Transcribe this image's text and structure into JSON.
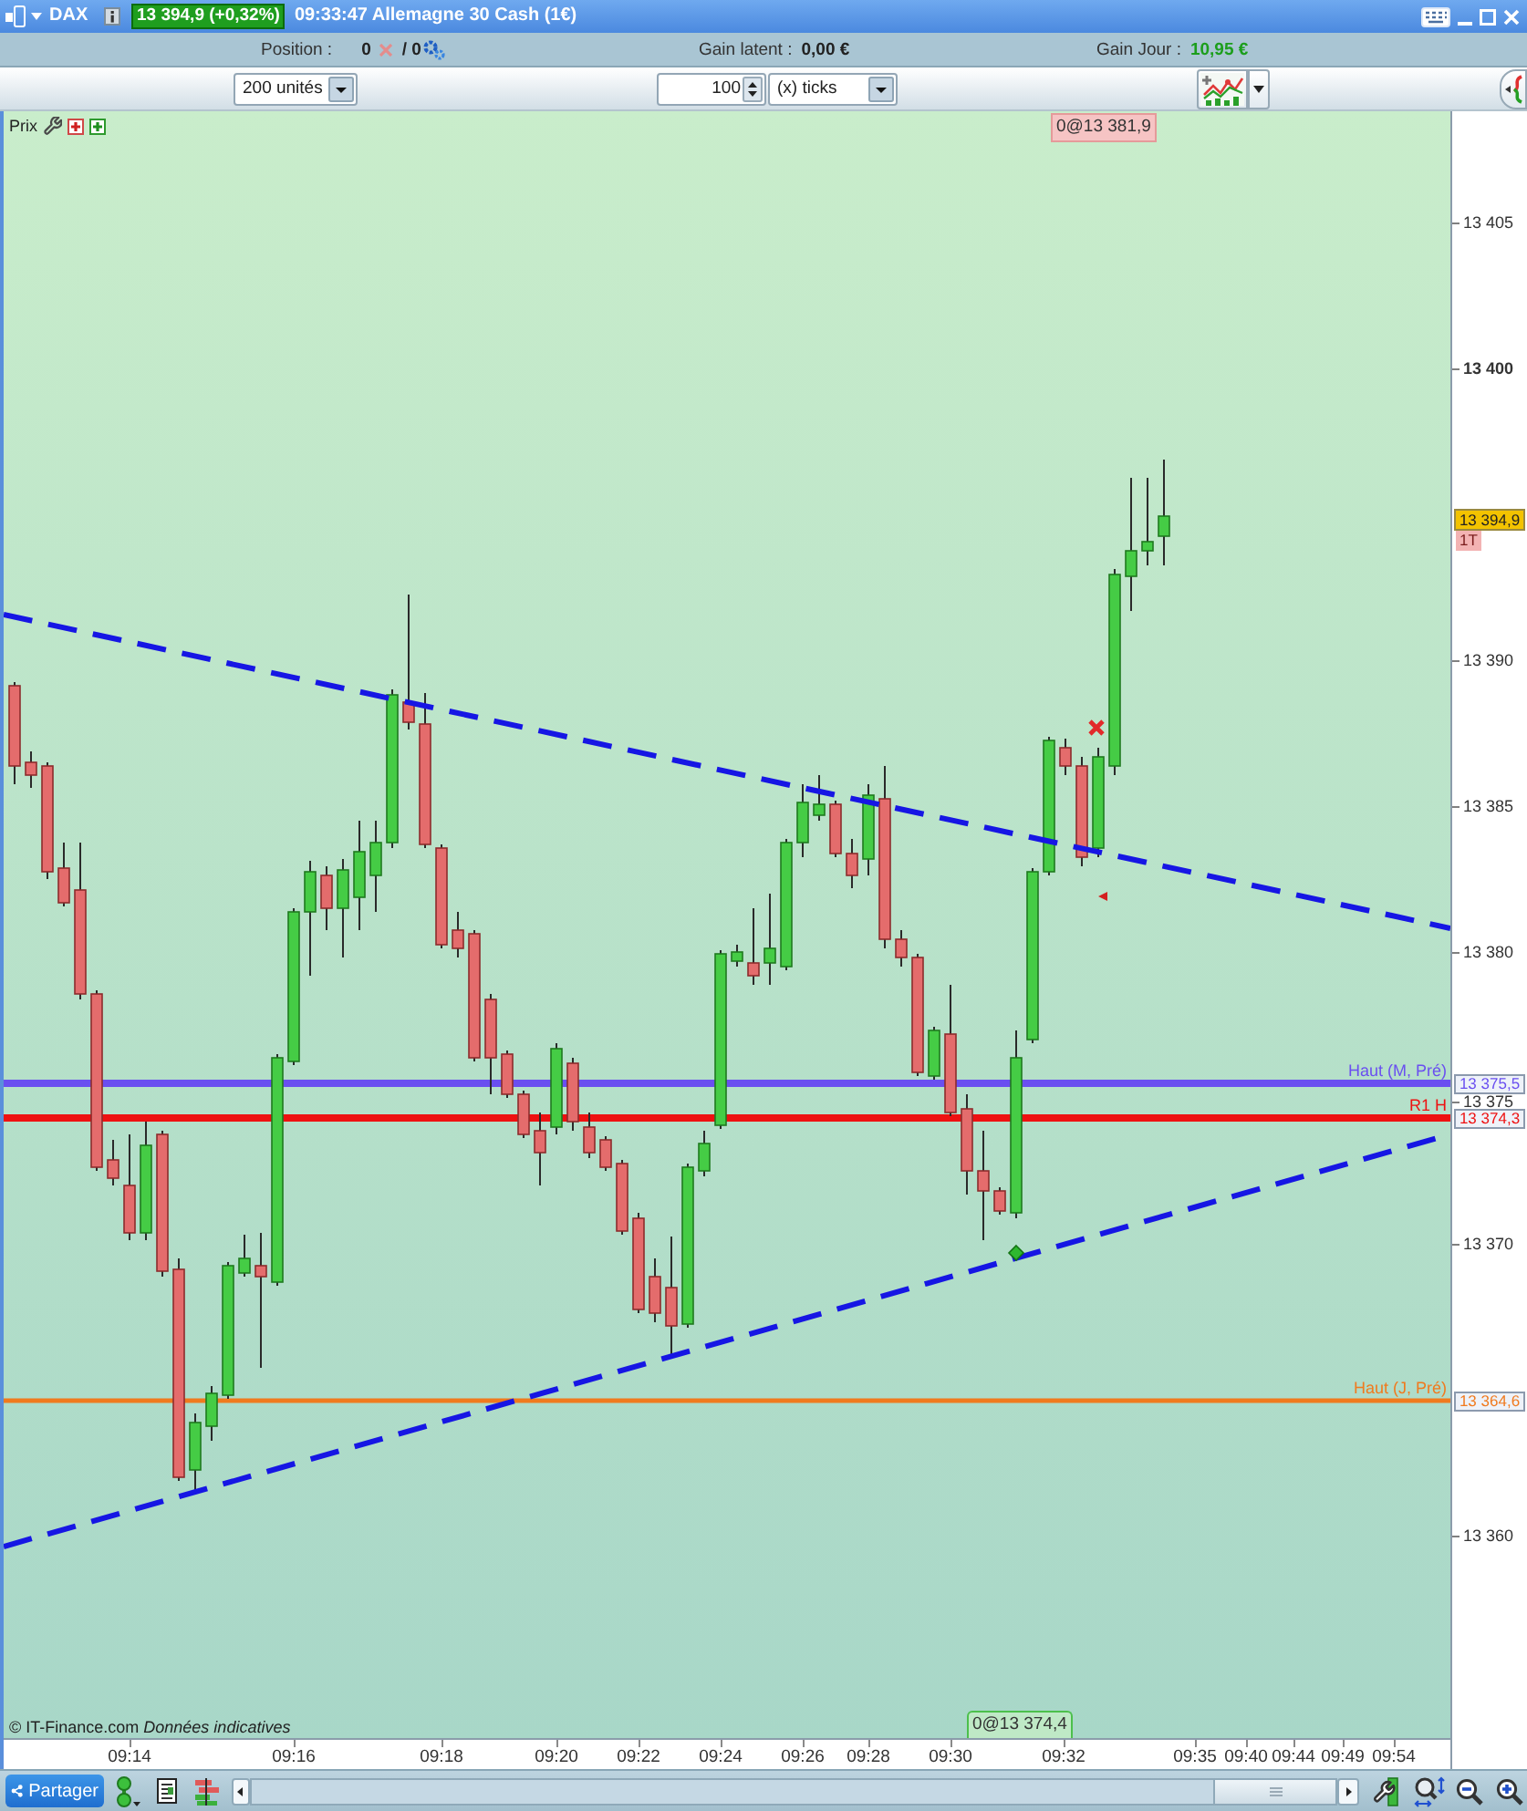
{
  "title_bar": {
    "instrument": "DAX",
    "quote": "13 394,9 (+0,32%)",
    "caption": "09:33:47 Allemagne 30 Cash (1€)"
  },
  "info_bar": {
    "position": {
      "label": "Position :",
      "value": "0",
      "total": "/ 0"
    },
    "unrealized": {
      "label": "Gain latent :",
      "value": "0,00 €"
    },
    "daily": {
      "label": "Gain Jour :",
      "value": "10,95 €"
    }
  },
  "toolbar": {
    "quantity": "200 unités",
    "step": "100",
    "step_unit": "(x) ticks"
  },
  "chart": {
    "panel_title": "Prix",
    "order_tags": [
      {
        "text": "0@13 381,9",
        "kind": "sell"
      },
      {
        "text": "0@13 374,4",
        "kind": "buy"
      }
    ],
    "source": "© IT-Finance.com *Données indicatives*",
    "price_ticks": [
      {
        "label": "13 405",
        "emphasized": false
      },
      {
        "label": "13 400",
        "emphasized": true
      },
      {
        "label": "13 390",
        "emphasized": false
      },
      {
        "label": "13 385",
        "emphasized": false
      },
      {
        "label": "13 380",
        "emphasized": false
      },
      {
        "label": "13 375",
        "emphasized": false
      },
      {
        "label": "13 370",
        "emphasized": false
      },
      {
        "label": "13 360",
        "emphasized": false
      }
    ],
    "last_price": {
      "value": "13 394,9",
      "tag": "1T"
    },
    "levels": [
      {
        "name": "Haut (M, Pré)",
        "price": "13 375,5",
        "color": "#6a4ff0"
      },
      {
        "name": "R1 H",
        "price": "13 374,3",
        "color": "#ee1111"
      },
      {
        "name": "Haut (J, Pré)",
        "price": "13 364,6",
        "color": "#f07a1e"
      }
    ],
    "time_ticks": [
      "09:14",
      "09:16",
      "09:18",
      "09:20",
      "09:22",
      "09:24",
      "09:26",
      "09:28",
      "09:30",
      "09:32",
      "09:35",
      "09:40",
      "09:44",
      "09:49",
      "09:54"
    ]
  },
  "bottom_bar": {
    "share_label": "Partager"
  }
}
